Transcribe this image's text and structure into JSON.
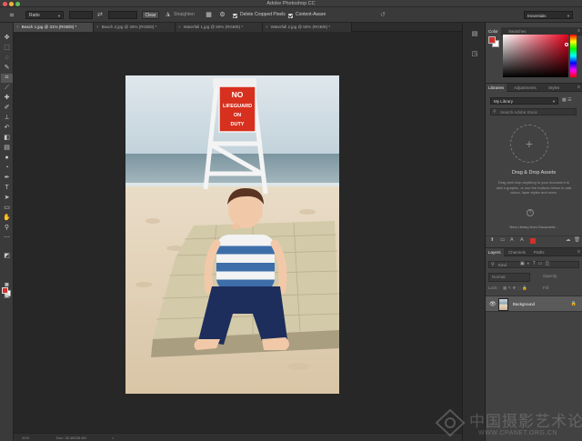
{
  "window": {
    "title": "Adobe Photoshop CC"
  },
  "options_bar": {
    "tool_icon": "crop-tool-icon",
    "ratio": "Ratio",
    "clear_label": "Clear",
    "straighten_label": "Straighten",
    "delete_cropped_label": "Delete Cropped Pixels",
    "content_aware_label": "Content-Aware",
    "workspace": "Essentials"
  },
  "tabs": [
    {
      "label": "Beach 1.jpg @ 31% (RGB/8) *",
      "active": true
    },
    {
      "label": "Beach 2.jpg @ 25% (RGB/8) *",
      "active": false
    },
    {
      "label": "Waterfall 1.jpg @ 50% (RGB/8) *",
      "active": false
    },
    {
      "label": "Waterfall 2.jpg @ 50% (RGB/8) *",
      "active": false
    }
  ],
  "canvas": {
    "sign_lines": [
      "NO",
      "LIFEGUARD",
      "ON",
      "DUTY"
    ]
  },
  "status_bar": {
    "zoom": "31%",
    "doc": "Doc: 28.4M/28.4M",
    "arrow": ">"
  },
  "color_panel": {
    "tabs": [
      "Color",
      "Swatches"
    ],
    "foreground": "#d4302a",
    "background": "#ffffff"
  },
  "libraries_panel": {
    "tabs": [
      "Libraries",
      "Adjustments",
      "Styles"
    ],
    "library": "My Library",
    "search_placeholder": "Search Adobe Stock",
    "title": "Drag & Drop Assets",
    "description": "Drag and drop anything to your document to add a graphic, or use the buttons below to add colors, layer styles and more.",
    "stock_link": "New Library from Document..."
  },
  "layers_panel": {
    "tabs": [
      "Layers",
      "Channels",
      "Paths"
    ],
    "filter": "Kind",
    "blend_mode": "Normal",
    "opacity_label": "Opacity:",
    "lock_label": "Lock:",
    "fill_label": "Fill:",
    "layer_name": "Background"
  },
  "watermark": {
    "chinese": "中国摄影艺术论坛",
    "url": "WWW.CPANET.ORG.CN"
  }
}
